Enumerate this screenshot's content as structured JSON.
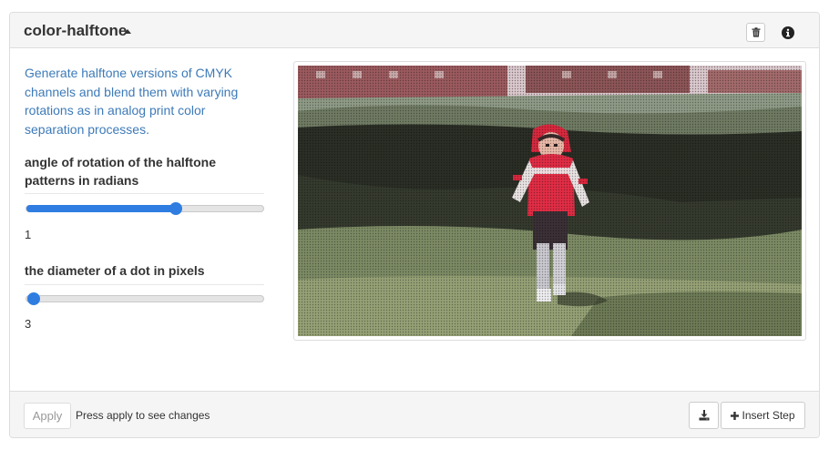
{
  "header": {
    "title": "color-halftone",
    "icons": {
      "collapse": "caret-up-icon",
      "delete": "trash-icon",
      "info": "info-circle-icon"
    }
  },
  "description": "Generate halftone versions of CMYK channels and blend them with varying rotations as in analog print color separation processes.",
  "params": [
    {
      "label": "angle of rotation of the halftone patterns in radians",
      "value": "1",
      "slider_fraction": 0.65
    },
    {
      "label": "the diameter of a dot in pixels",
      "value": "3",
      "slider_fraction": 0.0
    }
  ],
  "preview": {
    "alt": "halftone image of a toddler in a red hooded jacket walking on grass"
  },
  "footer": {
    "apply_label": "Apply",
    "apply_hint": "Press apply to see changes",
    "download_icon": "download-icon",
    "insert_icon": "plus-icon",
    "insert_label": "Insert Step"
  },
  "colors": {
    "accent": "#2f7de1",
    "description_text": "#3d7ab8"
  }
}
